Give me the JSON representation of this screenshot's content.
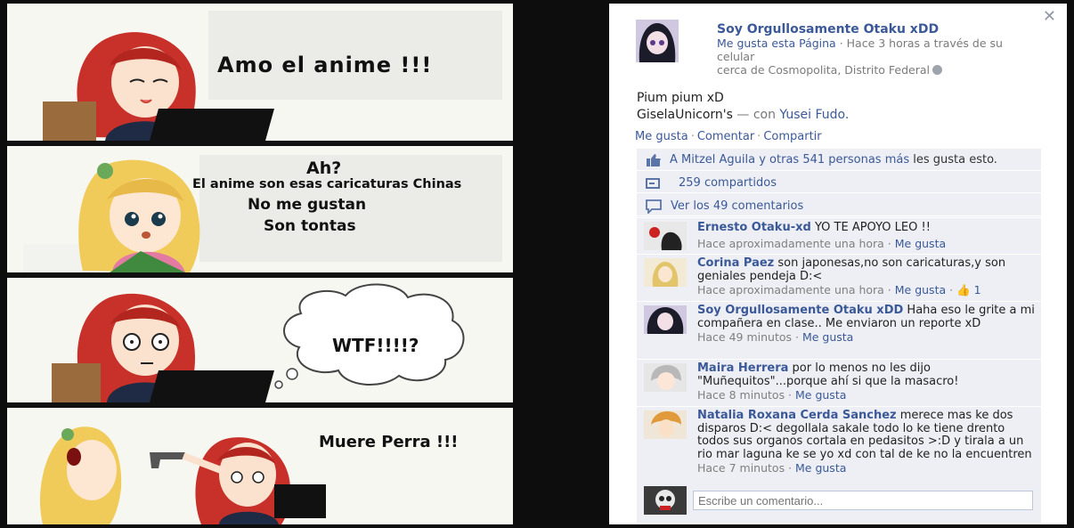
{
  "comic": {
    "panel1": {
      "caption": "Amo el anime !!!"
    },
    "panel2": {
      "line1": "Ah?",
      "line2": "El anime son esas caricaturas Chinas",
      "line3": "No me gustan",
      "line4": "Son tontas"
    },
    "panel3": {
      "bubble": "WTF!!!!?"
    },
    "panel4": {
      "caption": "Muere Perra !!!"
    }
  },
  "post": {
    "close": "✕",
    "page_name": "Soy Orgullosamente Otaku xDD",
    "like_page": "Me gusta esta Página",
    "meta_time": " · Hace 3 horas a través de su celular",
    "location": "cerca de Cosmopolita, Distrito Federal",
    "text_line1": "Pium pium xD",
    "text_line2_prefix": "GiselaUnicorn's",
    "text_line2_mid": " — con ",
    "text_line2_tag": "Yusei Fudo.",
    "actions": {
      "like": "Me gusta",
      "comment": "Comentar",
      "share": "Compartir"
    },
    "likes_link": "A Mitzel Aguila y otras 541 personas más",
    "likes_suffix": " les gusta esto.",
    "shares": "259 compartidos",
    "view_comments": "Ver los 49 comentarios",
    "comments": [
      {
        "author": "Ernesto Otaku-xd",
        "text": " YO TE APOYO LEO !!",
        "time": "Hace aproximadamente una hora",
        "like": "Me gusta",
        "likes": ""
      },
      {
        "author": "Corina Paez",
        "text": " son japonesas,no son caricaturas,y son geniales pendeja D:<",
        "time": "Hace aproximadamente una hora",
        "like": "Me gusta",
        "likes": "1"
      },
      {
        "author": "Soy Orgullosamente Otaku xDD",
        "text": " Haha eso le grite a mi compañera en clase.. Me enviaron un reporte xD",
        "time": "Hace 49 minutos",
        "like": "Me gusta",
        "likes": ""
      },
      {
        "author": "Maira Herrera",
        "text": " por lo menos no les dijo \"Muñequitos\"...porque ahí si que la masacro!",
        "time": "Hace 8 minutos",
        "like": "Me gusta",
        "likes": ""
      },
      {
        "author": "Natalia Roxana Cerda Sanchez",
        "text": " merece mas ke dos disparos D:< degollala sakale todo lo ke tiene drento todos sus organos cortala en pedasitos >:D y tirala a un rio mar laguna ke se yo xd con tal de ke no la encuentren",
        "time": "Hace 7 minutos",
        "like": "Me gusta",
        "likes": ""
      }
    ],
    "reply_placeholder": "Escribe un comentario..."
  }
}
